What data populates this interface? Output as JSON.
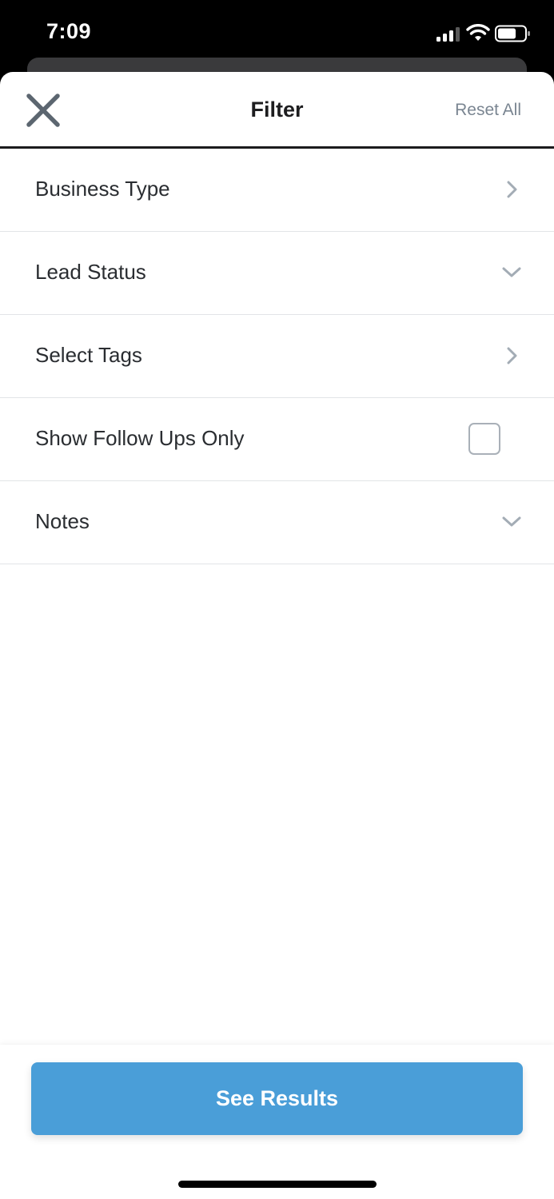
{
  "status_bar": {
    "time": "7:09",
    "icons": [
      "signal-icon",
      "wifi-icon",
      "battery-icon"
    ]
  },
  "header": {
    "close_icon": "close-icon",
    "title": "Filter",
    "reset_label": "Reset All"
  },
  "filters": [
    {
      "label": "Business Type",
      "control": "chevron-right-icon"
    },
    {
      "label": "Lead Status",
      "control": "chevron-down-icon"
    },
    {
      "label": "Select Tags",
      "control": "chevron-right-icon"
    },
    {
      "label": "Show Follow Ups Only",
      "control": "checkbox",
      "checked": false
    },
    {
      "label": "Notes",
      "control": "chevron-down-icon"
    }
  ],
  "footer": {
    "button_label": "See Results"
  },
  "colors": {
    "accent": "#4a9ed8",
    "secondary_text": "#7a8591",
    "chevron": "#a3acb5"
  }
}
